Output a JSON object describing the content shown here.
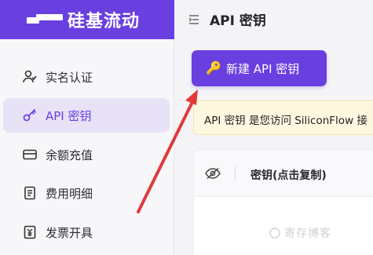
{
  "brand": {
    "name": "硅基流动",
    "logo_icon": "siliconflow-logo",
    "color": "#6a3fe0"
  },
  "header": {
    "title": "API 密钥",
    "menu_icon": "menu-collapse-icon"
  },
  "sidebar": {
    "items": [
      {
        "label": "实名认证",
        "icon": "user-check-icon",
        "active": false
      },
      {
        "label": "API 密钥",
        "icon": "key-icon",
        "active": true
      },
      {
        "label": "余额充值",
        "icon": "card-icon",
        "active": false
      },
      {
        "label": "费用明细",
        "icon": "document-icon",
        "active": false
      },
      {
        "label": "发票开具",
        "icon": "invoice-icon",
        "active": false
      }
    ]
  },
  "main": {
    "create_button": {
      "icon": "🔑",
      "label": "新建 API 密钥"
    },
    "notice": {
      "text": "API 密钥 是您访问 SiliconFlow 接"
    },
    "table": {
      "columns": [
        {
          "label": "密钥(点击复制)"
        }
      ],
      "visibility_icon": "eye-off-icon"
    }
  },
  "watermark": {
    "text": "寄存博客"
  },
  "colors": {
    "accent": "#6a3fe0",
    "active_bg": "#e7e2f6",
    "notice_bg": "#fff8e0",
    "arrow": "#e03a3a"
  }
}
